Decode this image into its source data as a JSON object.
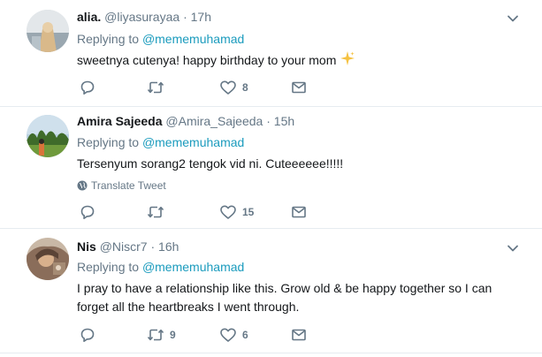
{
  "tweets": [
    {
      "name": "alia.",
      "handle": "@liyasurayaa",
      "dot": "·",
      "time": "17h",
      "replying_prefix": "Replying to",
      "replying_to": "@mememuhamad",
      "text": "sweetnya cutenya! happy birthday to your mom",
      "emoji_icon": "sparkles-icon",
      "translate": "",
      "reply_count": "",
      "retweet_count": "",
      "like_count": "8"
    },
    {
      "name": "Amira Sajeeda",
      "handle": "@Amira_Sajeeda",
      "dot": "·",
      "time": "15h",
      "replying_prefix": "Replying to",
      "replying_to": "@mememuhamad",
      "text": "Tersenyum sorang2 tengok vid ni. Cuteeeeee!!!!!",
      "translate": "Translate Tweet",
      "reply_count": "",
      "retweet_count": "",
      "like_count": "15"
    },
    {
      "name": "Nis",
      "handle": "@Niscr7",
      "dot": "·",
      "time": "16h",
      "replying_prefix": "Replying to",
      "replying_to": "@mememuhamad",
      "text": "I pray to have a relationship like this. Grow old & be happy together so I can forget all the heartbreaks I went through.",
      "translate": "",
      "reply_count": "",
      "retweet_count": "9",
      "like_count": "6"
    }
  ],
  "colors": {
    "muted": "#657786",
    "mention": "#1a9bbd",
    "border": "#e6ecf0",
    "text": "#14171a"
  }
}
